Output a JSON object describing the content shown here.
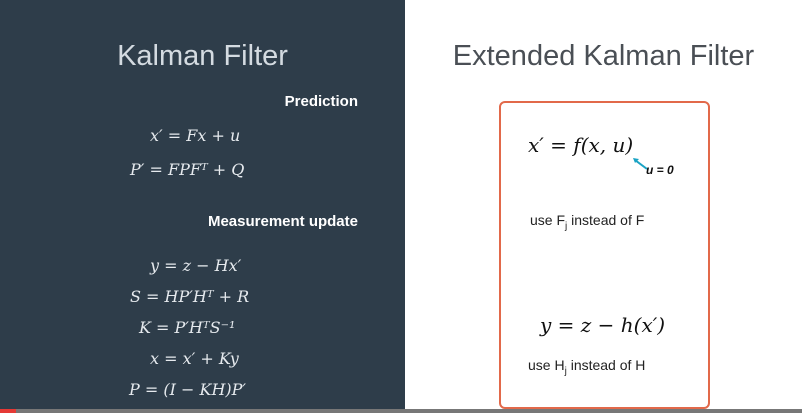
{
  "left_panel": {
    "title": "Kalman Filter",
    "prediction_label": "Prediction",
    "prediction_eqs": [
      "x′ = Fx + u",
      "P′ = FPFᵀ + Q"
    ],
    "measurement_label": "Measurement update",
    "measurement_eqs": [
      "y = z − Hx′",
      "S = HP′Hᵀ + R",
      "K = P′HᵀS⁻¹",
      "x = x′ + Ky",
      "P = (I − KH)P′"
    ]
  },
  "right_panel": {
    "title": "Extended Kalman Filter",
    "eq_prediction": "x′ = f(x, u)",
    "u_note": "u = 0",
    "note1_pre": "use F",
    "note1_sub": "j",
    "note1_post": " instead of F",
    "eq_update": "y = z − h(x′)",
    "note2_pre": "use H",
    "note2_sub": "j",
    "note2_post": " instead of H"
  },
  "colors": {
    "left_bg": "#2e3d4a",
    "box_border": "#e2694a",
    "arrow": "#1aa3c4",
    "progress": "#e53935"
  },
  "video": {
    "progress": 0.02
  }
}
